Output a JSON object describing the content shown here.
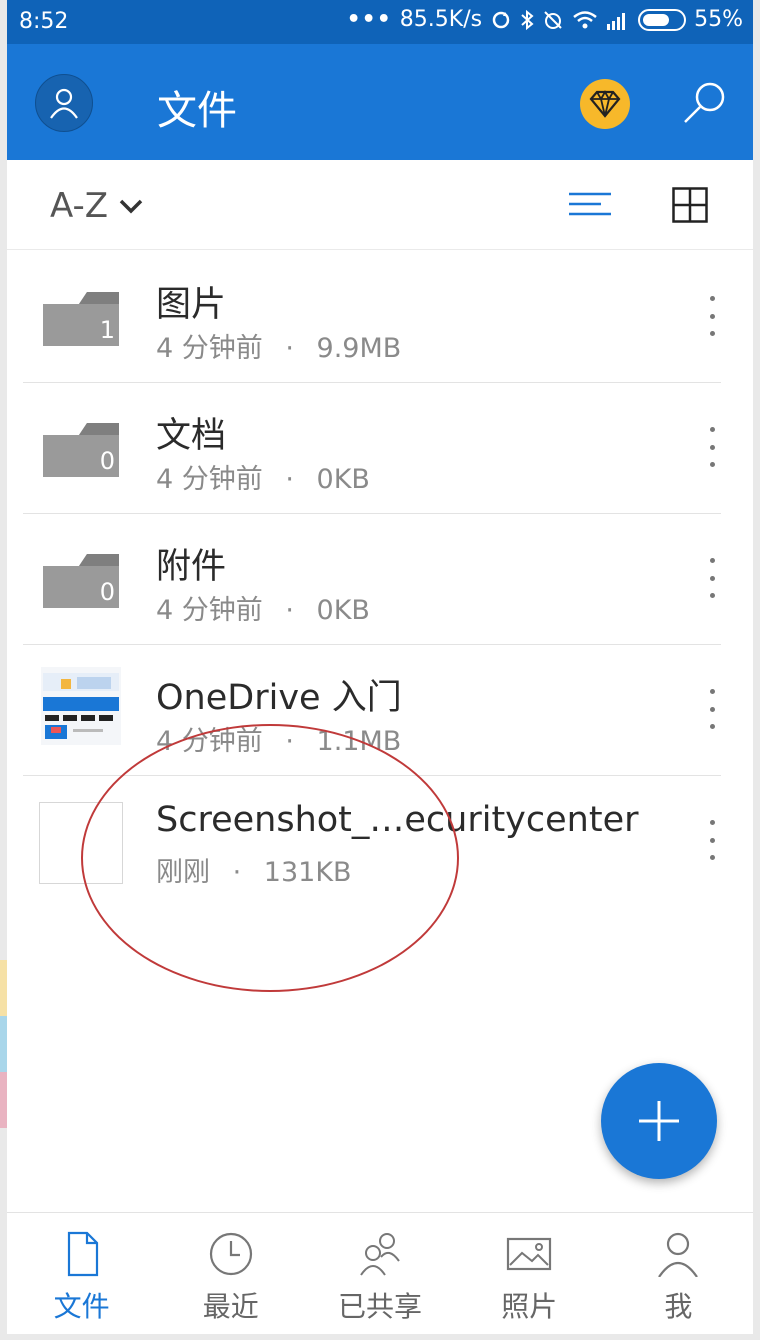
{
  "status_bar": {
    "time": "8:52",
    "net_speed": "85.5K/s",
    "battery": "55%",
    "icons": [
      "more-dots-icon",
      "sync-icon",
      "bluetooth-icon",
      "alarm-off-icon",
      "wifi-icon",
      "signal-icon",
      "battery-icon"
    ]
  },
  "app_bar": {
    "title": "文件",
    "icons": [
      "avatar-icon",
      "premium-diamond-icon",
      "search-icon"
    ],
    "colors": {
      "primary": "#1a77d6",
      "status": "#0f63b8",
      "premium": "#f7b82a"
    }
  },
  "toolbar": {
    "sort_label": "A-Z",
    "icons": [
      "chevron-down-icon",
      "list-view-icon",
      "grid-view-icon"
    ]
  },
  "files": [
    {
      "name": "图片",
      "time": "4 分钟前",
      "size": "9.9MB",
      "type": "folder",
      "count": "1"
    },
    {
      "name": "文档",
      "time": "4 分钟前",
      "size": "0KB",
      "type": "folder",
      "count": "0"
    },
    {
      "name": "附件",
      "time": "4 分钟前",
      "size": "0KB",
      "type": "folder",
      "count": "0"
    },
    {
      "name": "OneDrive 入门",
      "time": "4 分钟前",
      "size": "1.1MB",
      "type": "document"
    },
    {
      "name": "Screenshot_…ecuritycenter",
      "time": "刚刚",
      "size": "131KB",
      "type": "image"
    }
  ],
  "meta_separator": "·",
  "fab": {
    "icon": "plus-icon"
  },
  "bottom_nav": [
    {
      "label": "文件",
      "icon": "file-icon",
      "active": true
    },
    {
      "label": "最近",
      "icon": "clock-icon",
      "active": false
    },
    {
      "label": "已共享",
      "icon": "people-icon",
      "active": false
    },
    {
      "label": "照片",
      "icon": "photo-icon",
      "active": false
    },
    {
      "label": "我",
      "icon": "person-icon",
      "active": false
    }
  ]
}
